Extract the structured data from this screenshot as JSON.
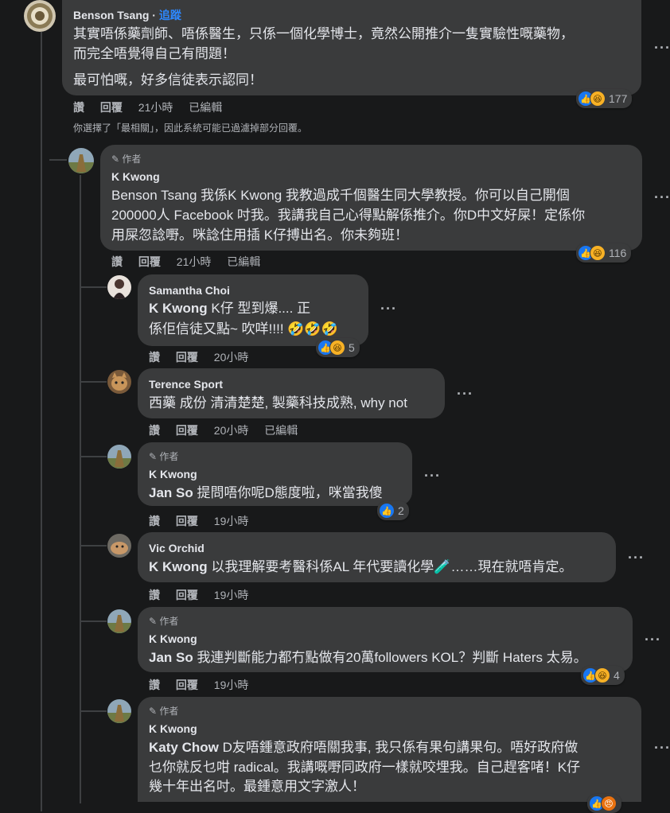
{
  "comments": {
    "c1": {
      "name": "Benson Tsang",
      "follow": "追蹤",
      "line1": "其實唔係藥劑師、唔係醫生，只係一個化學博士，竟然公開推介一隻實驗性嘅藥物，",
      "line2": "而完全唔覺得自己有問題！",
      "line3": "最可怕嘅，好多信徒表示認同！",
      "reactions": "177",
      "time": "21小時",
      "edited": "已編輯"
    },
    "filter_note": "你選擇了「最相關」，因此系統可能已過濾掉部分回覆。",
    "c2": {
      "author_badge": "作者",
      "name": "K Kwong",
      "line1": "Benson Tsang 我係K Kwong 我教過成千個醫生同大學教授。你可以自己開個",
      "line2": "200000人 Facebook 吋我。我講我自己心得點解係推介。你D中文好屎！定係你",
      "line3": "用屎忽諗嘢。咪諗住用插 K仔搏出名。你未夠班！",
      "reactions": "116",
      "time": "21小時",
      "edited": "已編輯"
    },
    "c3": {
      "name": "Samantha Choi",
      "mention": "K Kwong",
      "line1": "K仔 型到爆.... 正",
      "line2": "係佢信徒又點~ 吹咩!!!! 🤣🤣🤣",
      "reactions": "5",
      "time": "20小時"
    },
    "c4": {
      "name": "Terence Sport",
      "line1": "西藥 成份 清清楚楚, 製藥科技成熟, why not",
      "time": "20小時",
      "edited": "已編輯"
    },
    "c5": {
      "author_badge": "作者",
      "name": "K Kwong",
      "mention": "Jan So",
      "line1": "提問唔你呢D態度啦，咪當我傻",
      "reactions": "2",
      "time": "19小時"
    },
    "c6": {
      "name": "Vic Orchid",
      "mention": "K Kwong",
      "line1": "以我理解要考醫科係AL 年代要讀化學🧪……現在就唔肯定。",
      "time": "19小時"
    },
    "c7": {
      "author_badge": "作者",
      "name": "K Kwong",
      "mention": "Jan So",
      "line1": "我連判斷能力都冇點做有20萬followers KOL？判斷 Haters 太易。",
      "reactions": "4",
      "time": "19小時"
    },
    "c8": {
      "author_badge": "作者",
      "name": "K Kwong",
      "mention": "Katy Chow",
      "line1": "D友唔鍾意政府唔關我事, 我只係有果句講果句。唔好政府做",
      "line2": "乜你就反乜咁 radical。我講嘅嘢同政府一樣就咬埋我。自己趕客啫！K仔",
      "line3": "幾十年出名吋。最鍾意用文字激人！"
    }
  },
  "actions": {
    "like": "讚",
    "reply": "回覆"
  },
  "colors": {
    "background": "#18191a",
    "bubble": "#3a3b3c",
    "text": "#e4e6eb",
    "secondary": "#b0b3b8",
    "link": "#2d88ff",
    "like": "#1877f2",
    "haha": "#f7b125"
  },
  "icons": [
    "more-options-icon",
    "like-reaction-icon",
    "haha-reaction-icon",
    "angry-reaction-icon",
    "pencil-icon"
  ]
}
